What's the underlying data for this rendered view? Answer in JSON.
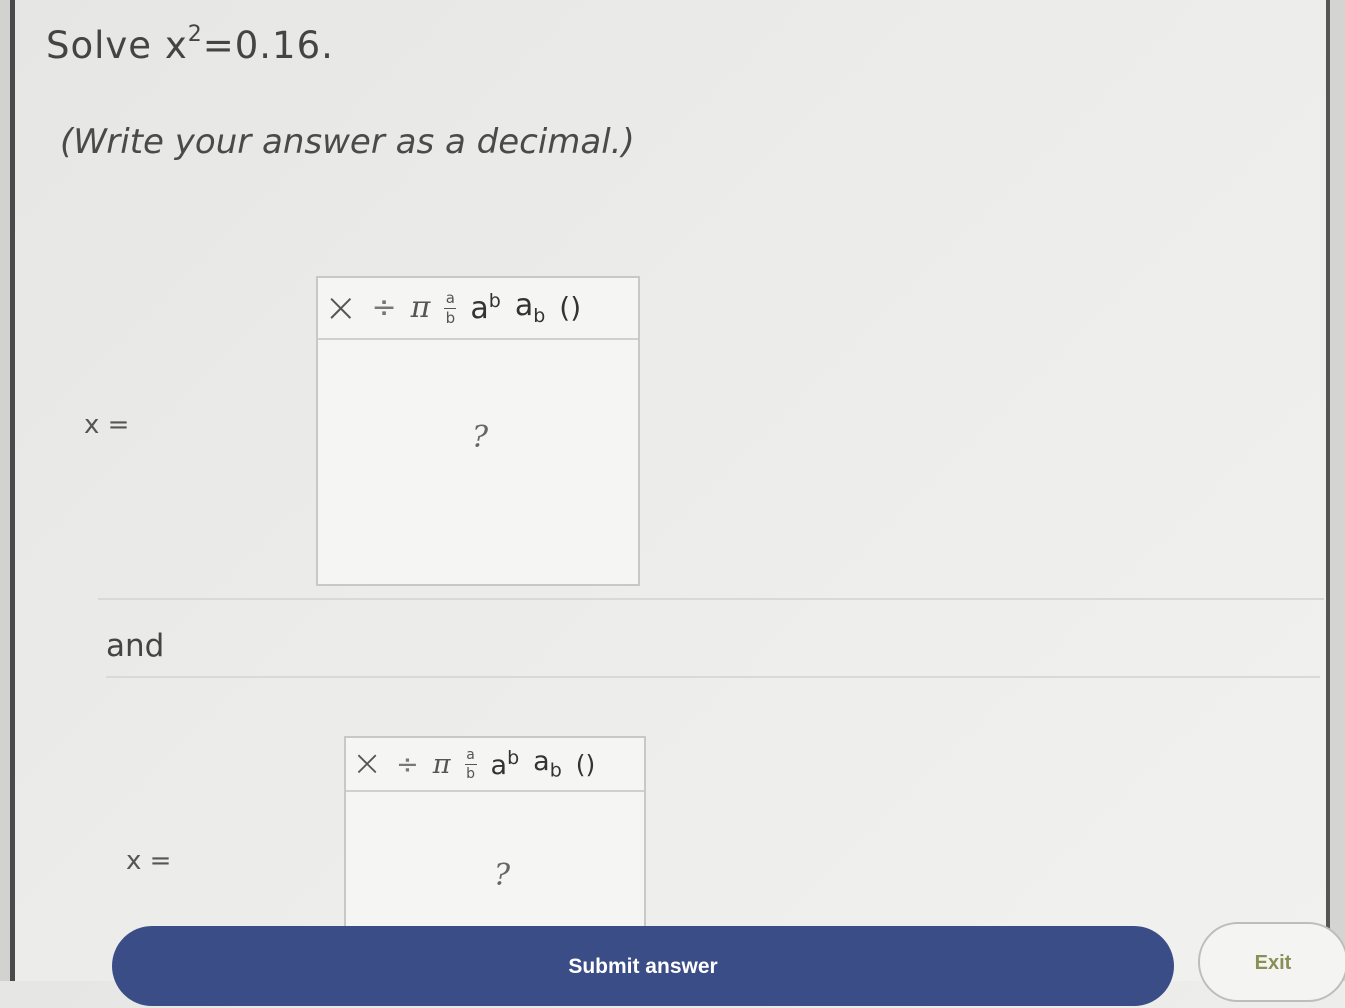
{
  "question": {
    "prefix": "Solve",
    "variable": "x",
    "exponent": "2",
    "rest": "=0.16."
  },
  "instruction": "(Write your answer as a decimal.)",
  "answers": [
    {
      "label": "x =",
      "placeholder": "?"
    },
    {
      "label": "x =",
      "placeholder": "?"
    }
  ],
  "separator_text": "and",
  "toolbar": {
    "times": "×",
    "divide": "÷",
    "pi": "π",
    "frac_num": "a",
    "frac_den": "b",
    "pow_base": "a",
    "pow_exp": "b",
    "sub_base": "a",
    "sub_idx": "b",
    "parens": "()"
  },
  "buttons": {
    "submit": "Submit answer",
    "exit": "Exit"
  }
}
